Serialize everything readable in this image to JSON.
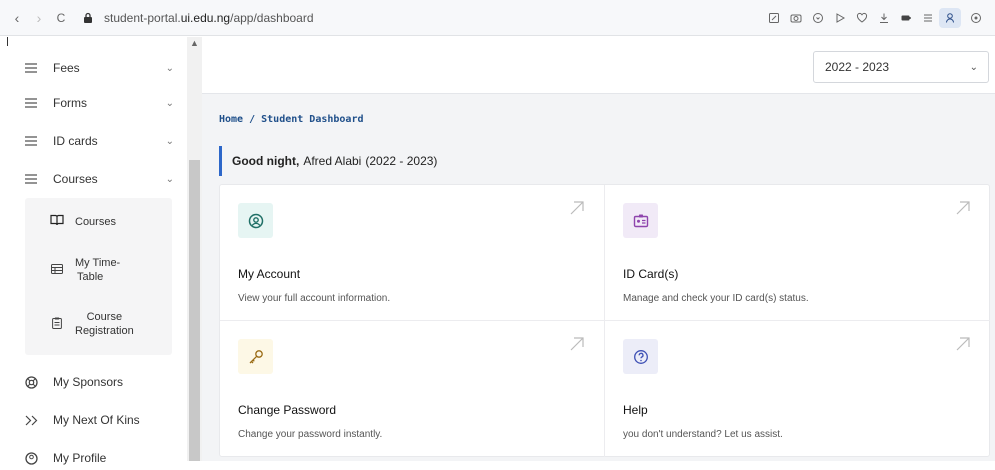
{
  "browser": {
    "url_prefix": "student-portal.",
    "url_domain": "ui.edu.ng",
    "url_path": "/app/dashboard",
    "back_glyph": "‹",
    "forward_glyph": "›",
    "reload_glyph": "C"
  },
  "sidebar": {
    "items": [
      {
        "label": "Fees",
        "icon": "menu-lines-icon",
        "expandable": true
      },
      {
        "label": "Forms",
        "icon": "menu-lines-icon",
        "expandable": true
      },
      {
        "label": "ID cards",
        "icon": "menu-lines-icon",
        "expandable": true
      },
      {
        "label": "Courses",
        "icon": "menu-lines-icon",
        "expandable": true,
        "expanded": true
      }
    ],
    "sub_items": [
      {
        "label_1": "Courses",
        "label_2": "",
        "icon": "book-open-icon"
      },
      {
        "label_1": "My Time-",
        "label_2": "Table",
        "icon": "timetable-icon"
      },
      {
        "label_1": "Course",
        "label_2": "Registration",
        "icon": "clipboard-icon"
      }
    ],
    "bottom_items": [
      {
        "label": "My Sponsors",
        "icon": "lifebuoy-icon"
      },
      {
        "label": "My Next Of Kins",
        "icon": "double-chevron-right-icon"
      },
      {
        "label": "My Profile",
        "icon": "profile-circle-icon"
      }
    ]
  },
  "topbar": {
    "session_selected": "2022 - 2023"
  },
  "breadcrumb": "Home / Student Dashboard",
  "greeting": {
    "salutation": "Good night,",
    "name": "Afred Alabi",
    "session": "(2022 - 2023)"
  },
  "cards": [
    {
      "title": "My Account",
      "desc": "View your full account information.",
      "icon": "user-circle-icon",
      "accent": "#2a9d8f",
      "bg": "#e6f5f3"
    },
    {
      "title": "ID Card(s)",
      "desc": "Manage and check your ID card(s) status.",
      "icon": "id-card-icon",
      "accent": "#8e44ad",
      "bg": "#f1eaf7"
    },
    {
      "title": "Change Password",
      "desc": "Change your password instantly.",
      "icon": "key-icon",
      "accent": "#b8860b",
      "bg": "#fdf8e6"
    },
    {
      "title": "Help",
      "desc": "you don't understand? Let us assist.",
      "icon": "help-circle-icon",
      "accent": "#3f51b5",
      "bg": "#ecedf8"
    }
  ],
  "colors": {
    "accent_blue": "#2d67c9",
    "breadcrumb": "#1f4f8a",
    "main_bg": "#f3f4f6"
  }
}
